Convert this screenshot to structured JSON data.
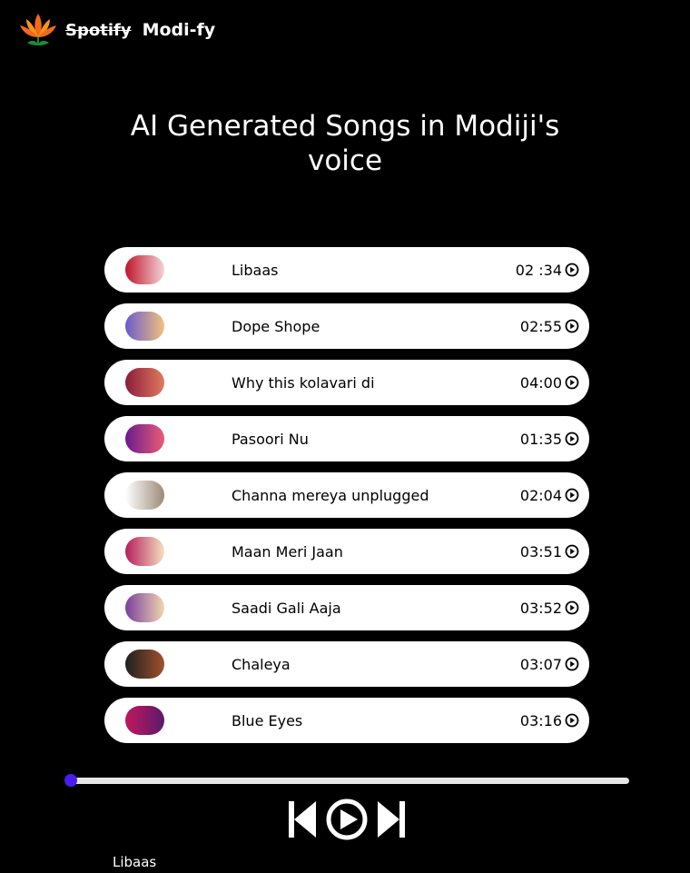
{
  "brand": {
    "old_name": "Spotify",
    "new_name": "Modi-fy"
  },
  "heading": {
    "line1": "AI Generated Songs in Modiji's",
    "line2": "voice"
  },
  "songs": [
    {
      "title": "Libaas",
      "duration": "02 :34",
      "thumb_colors": [
        "#c0152a",
        "#f3d4d8"
      ]
    },
    {
      "title": "Dope Shope",
      "duration": "02:55",
      "thumb_colors": [
        "#6a5acd",
        "#f1c27d"
      ]
    },
    {
      "title": "Why this kolavari di",
      "duration": "04:00",
      "thumb_colors": [
        "#8b1c3a",
        "#e07a5f"
      ]
    },
    {
      "title": "Pasoori Nu",
      "duration": "01:35",
      "thumb_colors": [
        "#6b1a8f",
        "#e85d75"
      ]
    },
    {
      "title": "Channa mereya unplugged",
      "duration": "02:04",
      "thumb_colors": [
        "#ffffff",
        "#9e8a78"
      ]
    },
    {
      "title": "Maan Meri Jaan",
      "duration": "03:51",
      "thumb_colors": [
        "#b71c5c",
        "#f4e1c1"
      ]
    },
    {
      "title": "Saadi Gali Aaja",
      "duration": "03:52",
      "thumb_colors": [
        "#7a3e9d",
        "#f2d5b1"
      ]
    },
    {
      "title": "Chaleya",
      "duration": "03:07",
      "thumb_colors": [
        "#1f1f1f",
        "#a0522d"
      ]
    },
    {
      "title": "Blue Eyes",
      "duration": "03:16",
      "thumb_colors": [
        "#c2185b",
        "#5a1a6b"
      ]
    }
  ],
  "player": {
    "now_playing": "Libaas",
    "progress": 0.0,
    "accent": "#4b1cf0"
  }
}
